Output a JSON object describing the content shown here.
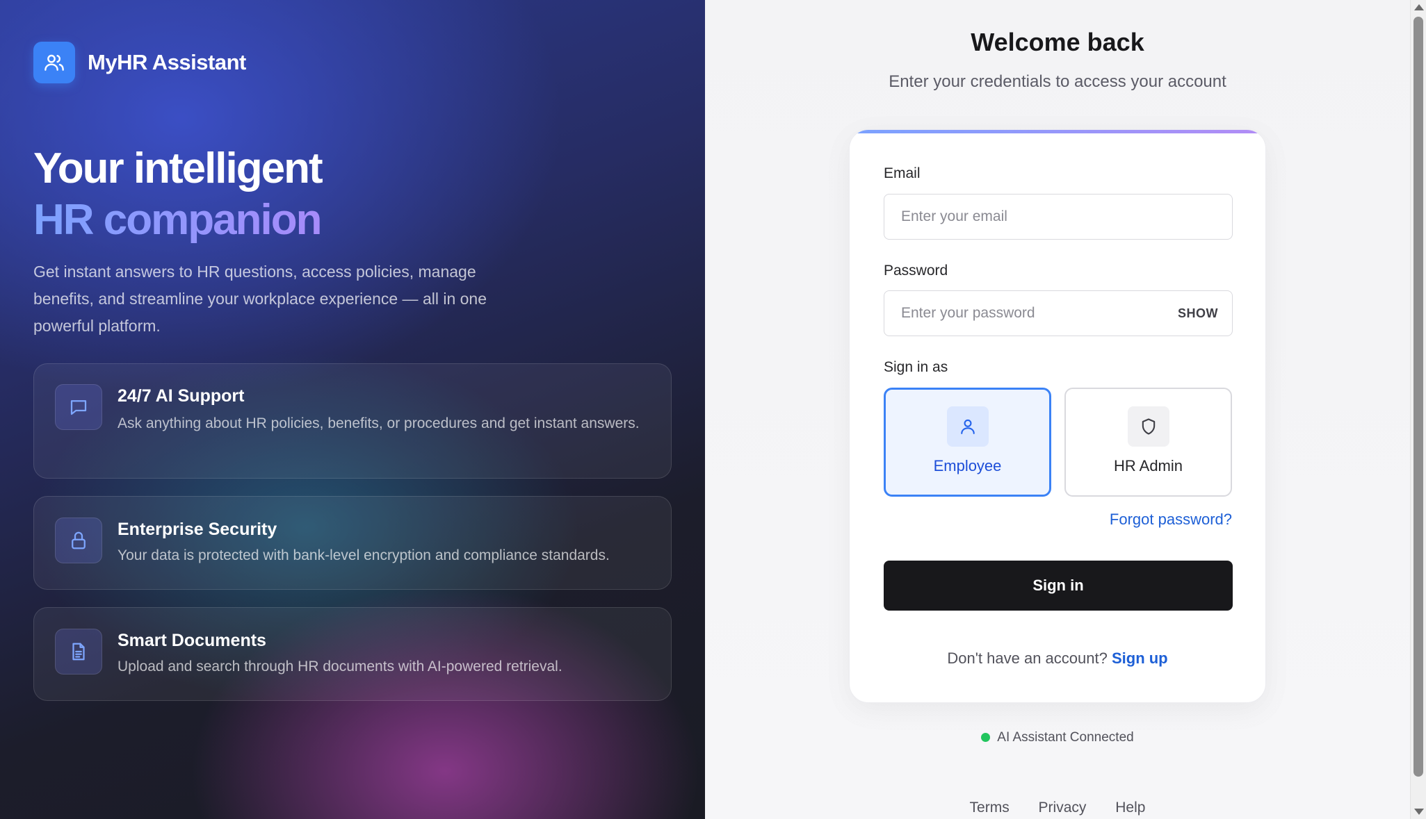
{
  "brand": {
    "name": "MyHR Assistant",
    "icon": "users-icon"
  },
  "hero": {
    "line1": "Your intelligent",
    "line2": "HR companion",
    "description": "Get instant answers to HR questions, access policies, manage benefits, and streamline your workplace experience — all in one powerful platform."
  },
  "features": [
    {
      "icon": "message-icon",
      "title": "24/7 AI Support",
      "description": "Ask anything about HR policies, benefits, or procedures and get instant answers."
    },
    {
      "icon": "lock-icon",
      "title": "Enterprise Security",
      "description": "Your data is protected with bank-level encryption and compliance standards."
    },
    {
      "icon": "document-icon",
      "title": "Smart Documents",
      "description": "Upload and search through HR documents with AI-powered retrieval."
    }
  ],
  "login": {
    "title": "Welcome back",
    "subtitle": "Enter your credentials to access your account",
    "email_label": "Email",
    "email_placeholder": "Enter your email",
    "email_value": "",
    "password_label": "Password",
    "password_placeholder": "Enter your password",
    "password_value": "",
    "show_label": "SHOW",
    "sign_in_as_label": "Sign in as",
    "roles": [
      {
        "label": "Employee",
        "icon": "user-icon",
        "selected": true
      },
      {
        "label": "HR Admin",
        "icon": "shield-icon",
        "selected": false
      }
    ],
    "forgot_label": "Forgot password?",
    "submit_label": "Sign in",
    "signup_prompt": "Don't have an account?",
    "signup_link": "Sign up"
  },
  "status": {
    "text": "AI Assistant Connected",
    "color": "#22c55e"
  },
  "footer": {
    "links": [
      "Terms",
      "Privacy",
      "Help"
    ]
  },
  "colors": {
    "accent": "#3b82f6",
    "link": "#1d5fd6",
    "button": "#18181b"
  }
}
